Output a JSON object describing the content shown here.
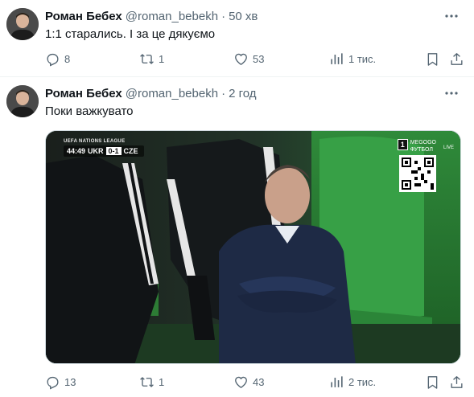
{
  "tweets": [
    {
      "author_name": "Роман Бебех",
      "handle": "@roman_bebekh",
      "separator": "·",
      "time": "50 хв",
      "text": "1:1 старались. І за це дякуємо",
      "stats": {
        "replies": "8",
        "reposts": "1",
        "likes": "53",
        "views": "1 тис."
      }
    },
    {
      "author_name": "Роман Бебех",
      "handle": "@roman_bebekh",
      "separator": "·",
      "time": "2 год",
      "text": "Поки важкувато",
      "media": {
        "league": "UEFA NATIONS LEAGUE",
        "match_clock": "44:49",
        "home_team": "UKR",
        "score": "0-1",
        "away_team": "CZE",
        "channel_number": "1",
        "broadcaster": "MEGOGO",
        "broadcaster_sub": "ФУТБОЛ",
        "live_label": "LIVE"
      },
      "stats": {
        "replies": "13",
        "reposts": "1",
        "likes": "43",
        "views": "2 тис."
      }
    }
  ],
  "icons": {
    "reply": "reply-icon",
    "repost": "repost-icon",
    "like": "heart-icon",
    "views": "views-icon",
    "bookmark": "bookmark-icon",
    "share": "share-icon",
    "more": "more-icon"
  },
  "colors": {
    "text_primary": "#0f1419",
    "text_secondary": "#536471",
    "divider": "#eff3f4"
  }
}
